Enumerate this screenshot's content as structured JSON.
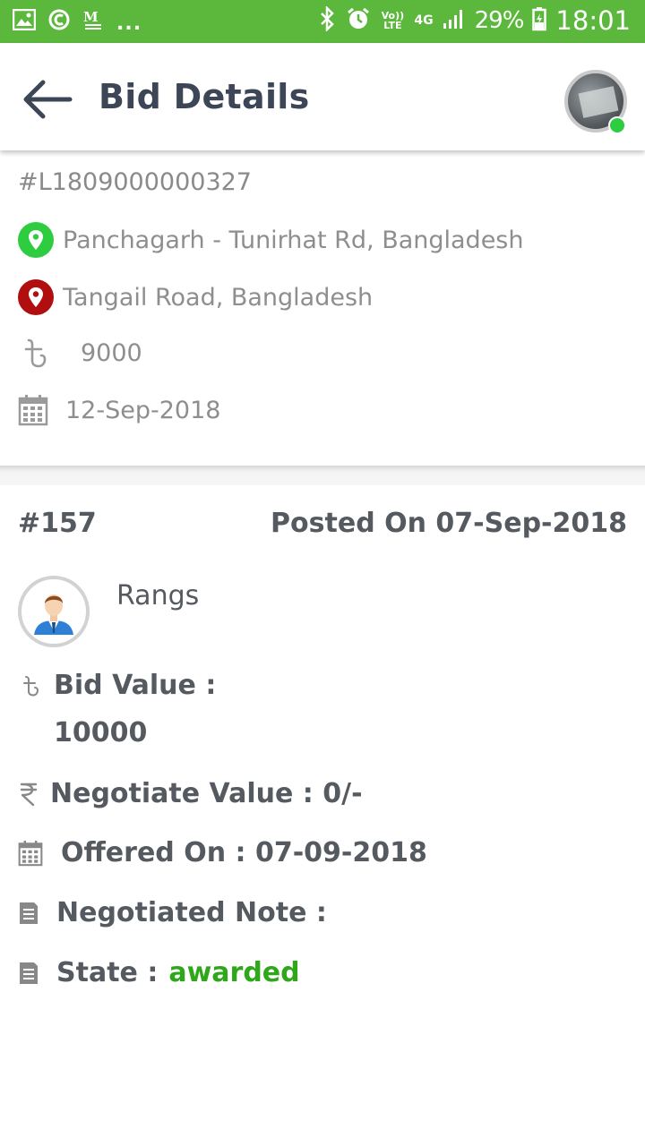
{
  "status_bar": {
    "battery": "29%",
    "time": "18:01",
    "overflow": "...",
    "network_type": "4G",
    "volte": "Vo)) LTE",
    "icons": [
      "image-icon",
      "cc-icon",
      "mail-icon",
      "bluetooth-icon",
      "alarm-icon",
      "signal-icon",
      "battery-icon"
    ]
  },
  "app_bar": {
    "title": "Bid Details"
  },
  "load": {
    "id": "#L1809000000327",
    "pickup": "Panchagarh - Tunirhat Rd, Bangladesh",
    "dropoff": "Tangail Road, Bangladesh",
    "amount": "9000",
    "date": "12-Sep-2018",
    "colors": {
      "pickup_pin": "#2ecc40",
      "dropoff_pin": "#b10f0f"
    }
  },
  "bid": {
    "id": "#157",
    "posted_on": "Posted On 07-Sep-2018",
    "bidder_name": "Rangs",
    "bid_value_label": "Bid Value :",
    "bid_value": "10000",
    "negotiate_value": "Negotiate Value : 0/-",
    "offered_on": "Offered On : 07-09-2018",
    "negotiated_note": "Negotiated Note :",
    "state_label": "State :",
    "state_value": "awarded",
    "colors": {
      "state": "#2ea81a"
    }
  }
}
